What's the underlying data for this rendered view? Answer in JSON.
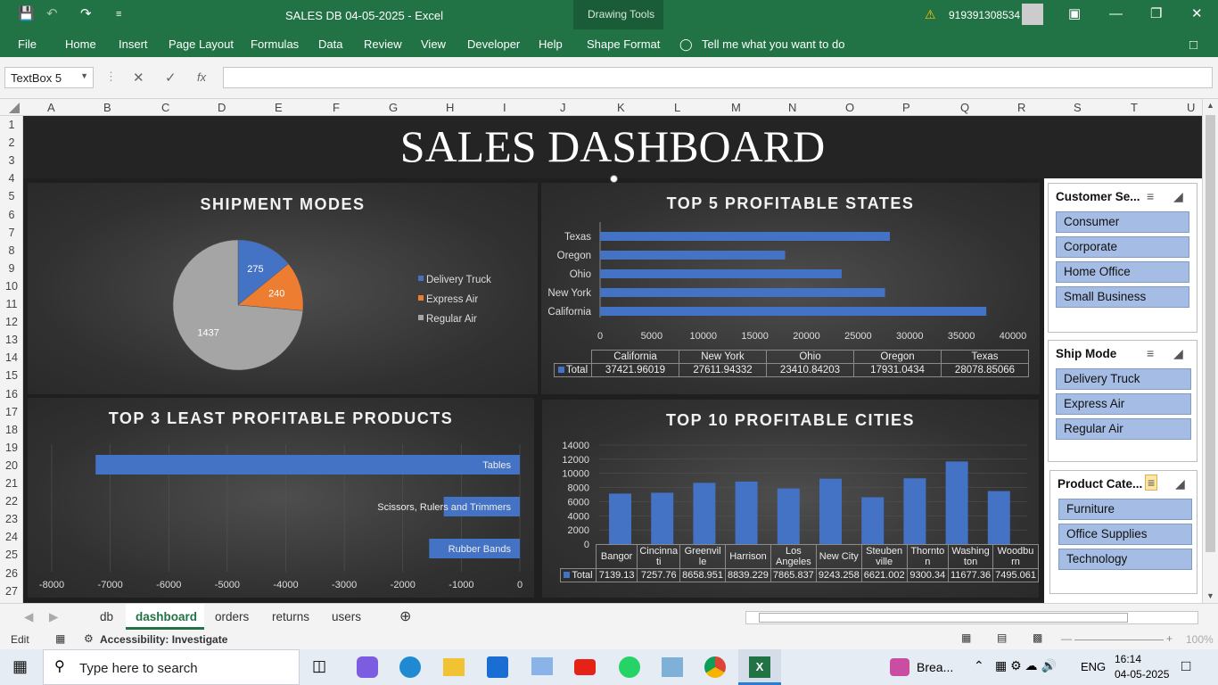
{
  "titlebar": {
    "title": "SALES DB 04-05-2025  -  Excel",
    "context": "Drawing Tools",
    "user": "919391308534"
  },
  "ribbon": {
    "tabs": [
      "File",
      "Home",
      "Insert",
      "Page Layout",
      "Formulas",
      "Data",
      "Review",
      "View",
      "Developer",
      "Help",
      "Shape Format"
    ],
    "tell_me": "Tell me what you want to do"
  },
  "formula_bar": {
    "name_box": "TextBox 5",
    "value": ""
  },
  "columns": [
    "A",
    "B",
    "C",
    "D",
    "E",
    "F",
    "G",
    "H",
    "I",
    "J",
    "K",
    "L",
    "M",
    "N",
    "O",
    "P",
    "Q",
    "R",
    "S",
    "T",
    "U"
  ],
  "rows": [
    "1",
    "2",
    "3",
    "4",
    "5",
    "6",
    "7",
    "8",
    "9",
    "10",
    "11",
    "12",
    "13",
    "14",
    "15",
    "16",
    "17",
    "18",
    "19",
    "20",
    "21",
    "22",
    "23",
    "24",
    "25",
    "26",
    "27"
  ],
  "dashboard": {
    "title": "SALES DASHBOARD"
  },
  "chart_data": [
    {
      "type": "pie",
      "title": "SHIPMENT MODES",
      "categories": [
        "Delivery Truck",
        "Express Air",
        "Regular Air"
      ],
      "values": [
        275,
        240,
        1437
      ],
      "colors": [
        "#4472c4",
        "#ed7d31",
        "#a5a5a5"
      ],
      "legend": "right"
    },
    {
      "type": "bar",
      "orientation": "horizontal",
      "title": "TOP 5 PROFITABLE STATES",
      "categories": [
        "Texas",
        "Oregon",
        "Ohio",
        "New York",
        "California"
      ],
      "values": [
        28078.85066,
        17931.0434,
        23410.84203,
        27611.94332,
        37421.96019
      ],
      "xlim": [
        0,
        40000
      ],
      "xticks": [
        "0",
        "5000",
        "10000",
        "15000",
        "20000",
        "25000",
        "30000",
        "35000",
        "40000"
      ],
      "table": {
        "series": "Total",
        "headers": [
          "California",
          "New York",
          "Ohio",
          "Oregon",
          "Texas"
        ],
        "values": [
          "37421.96019",
          "27611.94332",
          "23410.84203",
          "17931.0434",
          "28078.85066"
        ]
      }
    },
    {
      "type": "bar",
      "orientation": "horizontal",
      "title": "TOP 3 LEAST PROFITABLE PRODUCTS",
      "categories": [
        "Tables",
        "Scissors, Rulers and Trimmers",
        "Rubber Bands"
      ],
      "values": [
        -7250,
        -1300,
        -1550
      ],
      "xlim": [
        -8000,
        0
      ],
      "xticks": [
        "-8000",
        "-7000",
        "-6000",
        "-5000",
        "-4000",
        "-3000",
        "-2000",
        "-1000",
        "0"
      ]
    },
    {
      "type": "bar",
      "title": "TOP 10 PROFITABLE CITIES",
      "categories": [
        "Bangor",
        "Cincinnati",
        "Greenville",
        "Harrison",
        "Los Angeles",
        "New City",
        "Steubenville",
        "Thornton",
        "Washington",
        "Woodburn"
      ],
      "values": [
        7139.13,
        7257.76,
        8658.951,
        8839.229,
        7865.837,
        9243.258,
        6621.002,
        9300.34,
        11677.36,
        7495.061
      ],
      "ylim": [
        0,
        14000
      ],
      "yticks": [
        "14000",
        "12000",
        "10000",
        "8000",
        "6000",
        "4000",
        "2000",
        "0"
      ],
      "table": {
        "series": "Total",
        "headers": [
          "Bangor",
          "Cincinna ti",
          "Greenvil le",
          "Harrison",
          "Los Angeles",
          "New City",
          "Steuben ville",
          "Thornto n",
          "Washing ton",
          "Woodbu rn"
        ],
        "values": [
          "7139.13",
          "7257.76",
          "8658.951",
          "8839.229",
          "7865.837",
          "9243.258",
          "6621.002",
          "9300.34",
          "11677.36",
          "7495.061"
        ]
      }
    }
  ],
  "slicers": [
    {
      "title": "Customer Se...",
      "items": [
        "Consumer",
        "Corporate",
        "Home Office",
        "Small Business"
      ]
    },
    {
      "title": "Ship Mode",
      "items": [
        "Delivery Truck",
        "Express Air",
        "Regular Air"
      ]
    },
    {
      "title": "Product Cate...",
      "items": [
        "Furniture",
        "Office Supplies",
        "Technology"
      ]
    }
  ],
  "sheets": {
    "tabs": [
      "db",
      "dashboard",
      "orders",
      "returns",
      "users"
    ],
    "active": "dashboard"
  },
  "status": {
    "mode": "Edit",
    "accessibility": "Accessibility: Investigate",
    "zoom": "100%"
  },
  "taskbar": {
    "search_placeholder": "Type here to search",
    "news": "Brea...",
    "lang": "ENG",
    "time": "16:14",
    "date": "04-05-2025"
  }
}
